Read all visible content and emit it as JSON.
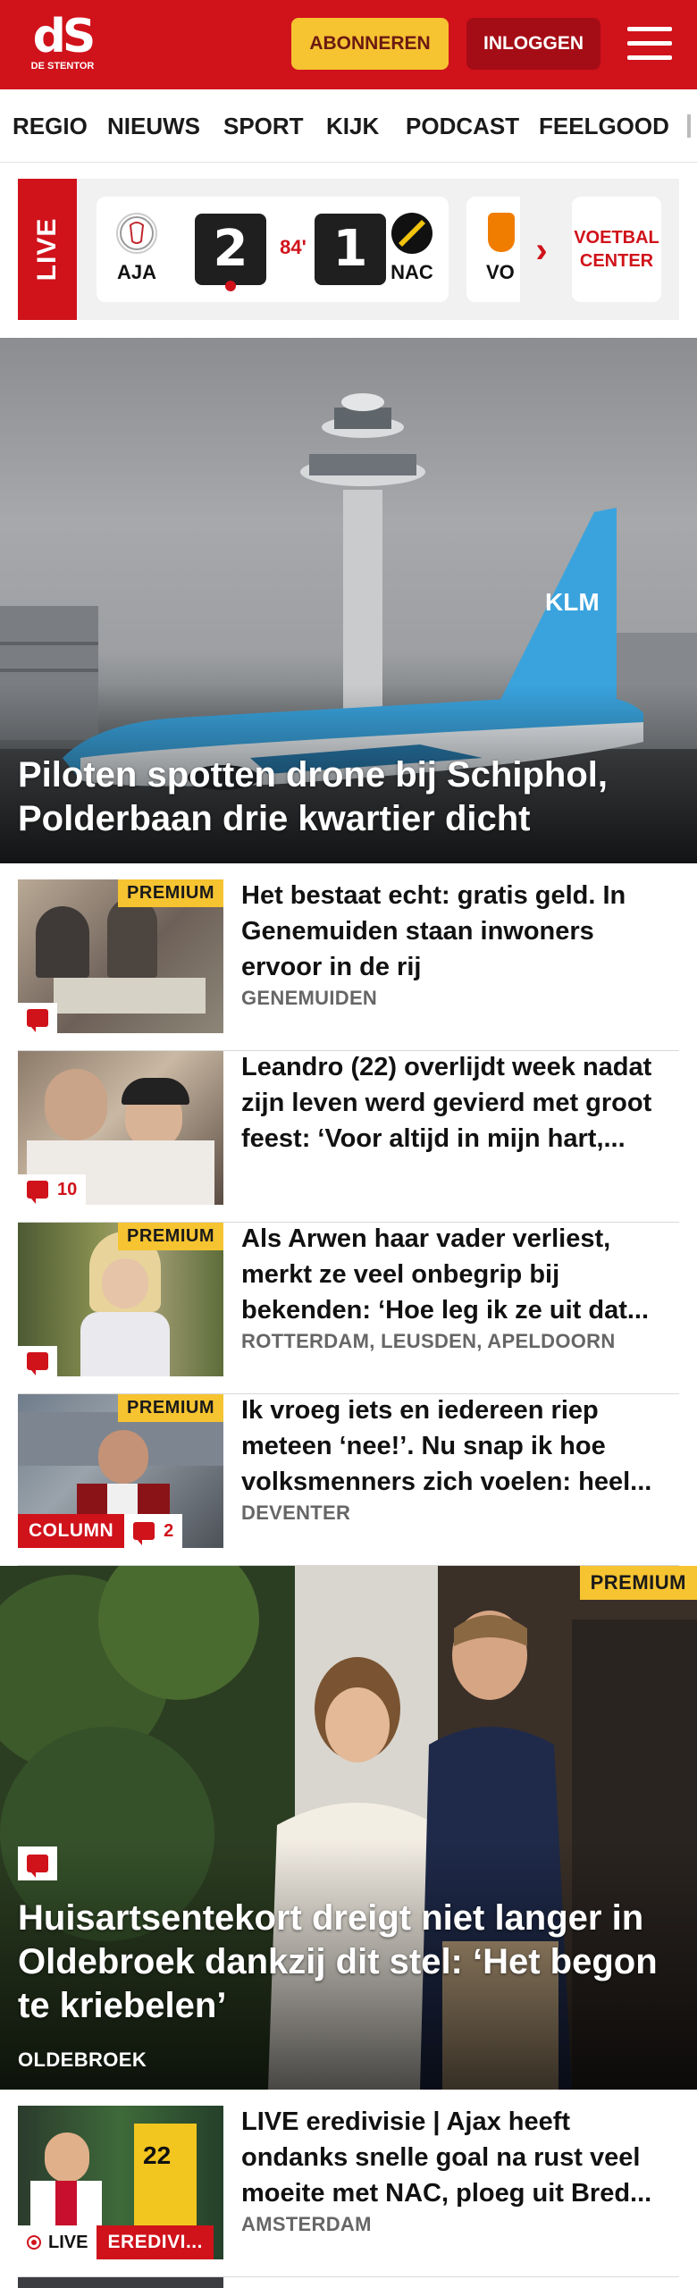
{
  "header": {
    "logo_mark": "dS",
    "logo_sub": "DE STENTOR",
    "subscribe_label": "ABONNEREN",
    "login_label": "INLOGGEN"
  },
  "nav": {
    "items": [
      "REGIO",
      "NIEUWS",
      "SPORT",
      "KIJK",
      "PODCAST",
      "FEELGOOD"
    ]
  },
  "live": {
    "tag": "LIVE",
    "match": {
      "home": "AJA",
      "away": "NAC",
      "home_score": "2",
      "away_score": "1",
      "minute": "84'"
    },
    "next_match_team": "VO",
    "voetbal_center_line1": "VOETBAL",
    "voetbal_center_line2": "CENTER"
  },
  "hero": {
    "title": "Piloten spotten drone bij Schiphol, Polderbaan drie kwartier dicht",
    "image_text": "KLM"
  },
  "articles": [
    {
      "title": "Het bestaat echt: gratis geld. In Genemuiden staan inwoners ervoor in de rij",
      "location": "GENEMUIDEN",
      "premium": "PREMIUM",
      "comments": ""
    },
    {
      "title": "Leandro (22) overlijdt week nadat zijn leven werd gevierd met groot feest: ‘Voor altijd in mijn hart,...",
      "location": "",
      "premium": "",
      "comments": "10"
    },
    {
      "title": "Als Arwen haar vader verliest, merkt ze veel onbegrip bij bekenden: ‘Hoe leg ik ze uit dat...",
      "location": "ROTTERDAM, LEUSDEN, APELDOORN",
      "premium": "PREMIUM",
      "comments": ""
    },
    {
      "title": "Ik vroeg iets en iedereen riep meteen ‘nee!’. Nu snap ik hoe volksmenners zich voelen: heel...",
      "location": "DEVENTER",
      "premium": "PREMIUM",
      "comments": "2",
      "column_label": "COLUMN"
    }
  ],
  "feature": {
    "premium": "PREMIUM",
    "title": "Huisartsentekort dreigt niet langer in Oldebroek dankzij dit stel: ‘Het begon te kriebelen’",
    "location": "OLDEBROEK"
  },
  "bottom_article": {
    "title": "LIVE eredivisie | Ajax heeft ondanks snelle goal na rust veel moeite met NAC, ploeg uit Bred...",
    "location": "AMSTERDAM",
    "live_label": "LIVE",
    "category_label": "EREDIVI..."
  },
  "colors": {
    "brand_red": "#d0121b",
    "premium_yellow": "#f6c331"
  }
}
